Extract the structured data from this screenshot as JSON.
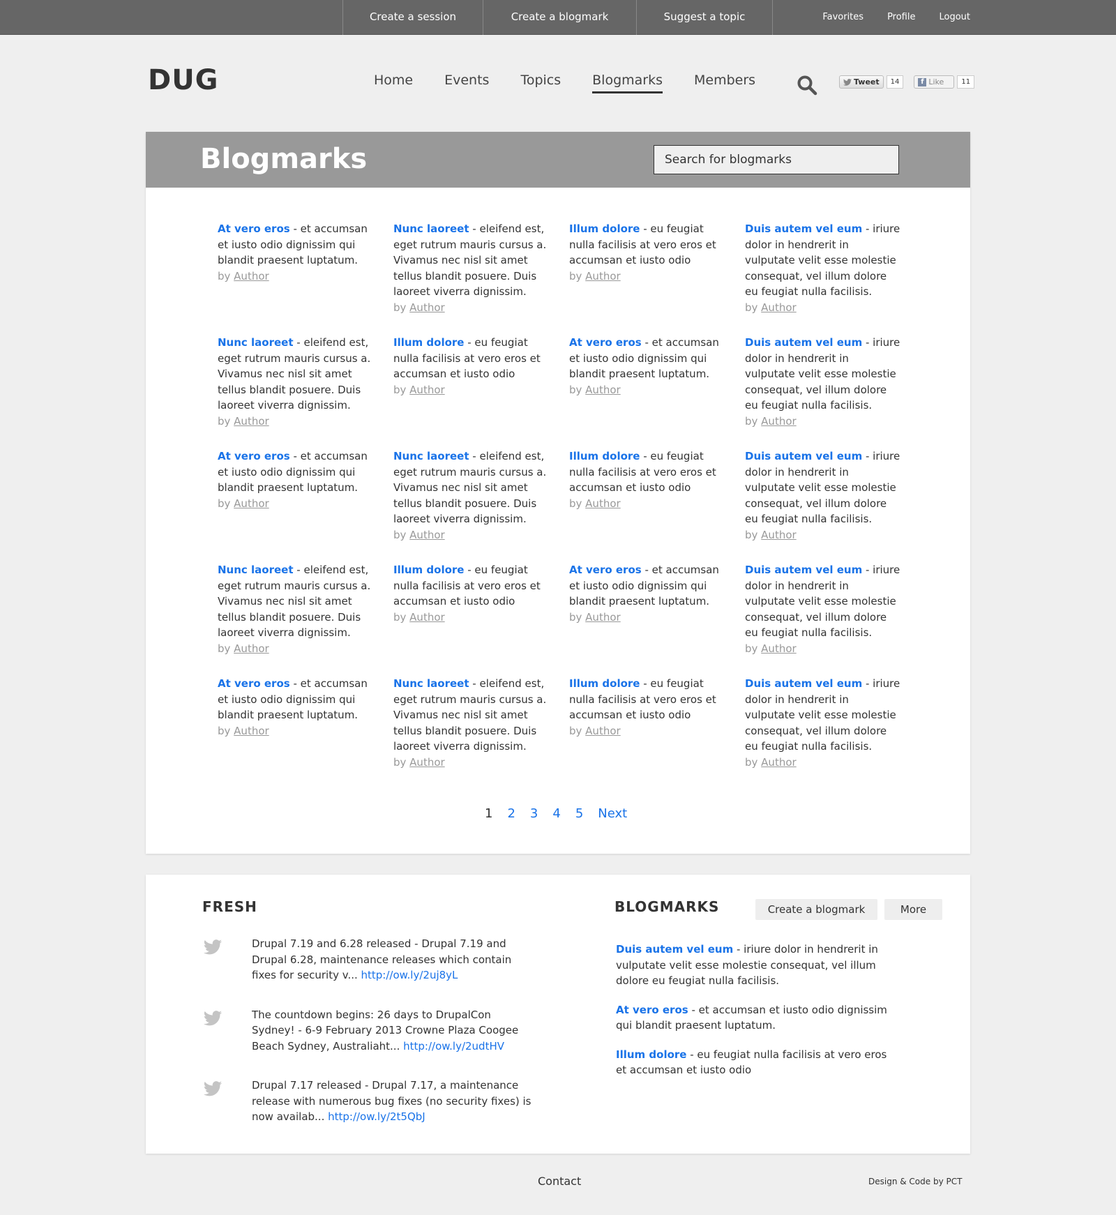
{
  "topbar": {
    "actions": [
      "Create a session",
      "Create a blogmark",
      "Suggest a topic"
    ],
    "user": [
      "Favorites",
      "Profile",
      "Logout"
    ]
  },
  "header": {
    "logo": "DUG",
    "nav": [
      "Home",
      "Events",
      "Topics",
      "Blogmarks",
      "Members"
    ],
    "active_nav": "Blogmarks",
    "tweet_label": "Tweet",
    "tweet_count": "14",
    "like_label": "Like",
    "like_count": "11"
  },
  "main": {
    "title": "Blogmarks",
    "search_placeholder": "Search for blogmarks",
    "rows": [
      [
        {
          "title": "At vero eros",
          "body": " - et accumsan et iusto odio dignissim qui blandit praesent luptatum.",
          "by": "by ",
          "author": "Author"
        },
        {
          "title": "Nunc laoreet",
          "body": " - eleifend est, eget rutrum mauris cursus a. Vivamus nec nisl sit amet tellus blandit posuere. Duis laoreet viverra dignissim.",
          "by": "by ",
          "author": "Author"
        },
        {
          "title": "Illum dolore",
          "body": " - eu feugiat nulla facilisis at vero eros et accumsan et iusto odio",
          "by": "by ",
          "author": "Author"
        },
        {
          "title": "Duis autem vel eum",
          "body": " - iriure dolor in hendrerit in vulputate velit esse molestie consequat, vel illum dolore eu feugiat nulla facilisis.",
          "by": "by ",
          "author": "Author"
        }
      ],
      [
        {
          "title": "Nunc laoreet",
          "body": " - eleifend est, eget rutrum mauris cursus a. Vivamus nec nisl sit amet tellus blandit posuere. Duis laoreet viverra dignissim.",
          "by": "by ",
          "author": "Author"
        },
        {
          "title": "Illum dolore",
          "body": " - eu feugiat nulla facilisis at vero eros et accumsan et iusto odio",
          "by": "by ",
          "author": "Author"
        },
        {
          "title": "At vero eros",
          "body": " - et accumsan et iusto odio dignissim qui blandit praesent luptatum.",
          "by": "by ",
          "author": "Author"
        },
        {
          "title": "Duis autem vel eum",
          "body": " - iriure dolor in hendrerit in vulputate velit esse molestie consequat, vel illum dolore eu feugiat nulla facilisis.",
          "by": "by ",
          "author": "Author"
        }
      ],
      [
        {
          "title": "At vero eros",
          "body": " - et accumsan et iusto odio dignissim qui blandit praesent luptatum.",
          "by": "by ",
          "author": "Author"
        },
        {
          "title": "Nunc laoreet",
          "body": " - eleifend est, eget rutrum mauris cursus a. Vivamus nec nisl sit amet tellus blandit posuere. Duis laoreet viverra dignissim.",
          "by": "by ",
          "author": "Author"
        },
        {
          "title": "Illum dolore",
          "body": " - eu feugiat nulla facilisis at vero eros et accumsan et iusto odio",
          "by": "by ",
          "author": "Author"
        },
        {
          "title": "Duis autem vel eum",
          "body": " - iriure dolor in hendrerit in vulputate velit esse molestie consequat, vel illum dolore eu feugiat nulla facilisis.",
          "by": "by ",
          "author": "Author"
        }
      ],
      [
        {
          "title": "Nunc laoreet",
          "body": " - eleifend est, eget rutrum mauris cursus a. Vivamus nec nisl sit amet tellus blandit posuere. Duis laoreet viverra dignissim.",
          "by": "by ",
          "author": "Author"
        },
        {
          "title": "Illum dolore",
          "body": " - eu feugiat nulla facilisis at vero eros et accumsan et iusto odio",
          "by": "by ",
          "author": "Author"
        },
        {
          "title": "At vero eros",
          "body": " - et accumsan et iusto odio dignissim qui blandit praesent luptatum.",
          "by": "by ",
          "author": "Author"
        },
        {
          "title": "Duis autem vel eum",
          "body": " - iriure dolor in hendrerit in vulputate velit esse molestie consequat, vel illum dolore eu feugiat nulla facilisis.",
          "by": "by ",
          "author": "Author"
        }
      ],
      [
        {
          "title": "At vero eros",
          "body": " - et accumsan et iusto odio dignissim qui blandit praesent luptatum.",
          "by": "by ",
          "author": "Author"
        },
        {
          "title": "Nunc laoreet",
          "body": " - eleifend est, eget rutrum mauris cursus a. Vivamus nec nisl sit amet tellus blandit posuere. Duis laoreet viverra dignissim.",
          "by": "by ",
          "author": "Author"
        },
        {
          "title": "Illum dolore",
          "body": " - eu feugiat nulla facilisis at vero eros et accumsan et iusto odio",
          "by": "by ",
          "author": "Author"
        },
        {
          "title": "Duis autem vel eum",
          "body": " - iriure dolor in hendrerit in vulputate velit esse molestie consequat, vel illum dolore eu feugiat nulla facilisis.",
          "by": "by ",
          "author": "Author"
        }
      ]
    ],
    "pager": {
      "current": "1",
      "pages": [
        "2",
        "3",
        "4",
        "5"
      ],
      "next": "Next"
    }
  },
  "fresh": {
    "title": "FRESH",
    "tweets": [
      {
        "text": "Drupal 7.19 and 6.28 released - Drupal 7.19 and Drupal 6.28, maintenance releases which contain fixes for security v... ",
        "link": "http://ow.ly/2uj8yL"
      },
      {
        "text": "The countdown begins: 26 days to DrupalCon Sydney! - 6-9 February 2013 Crowne Plaza Coogee Beach Sydney, Australiaht... ",
        "link": "http://ow.ly/2udtHV"
      },
      {
        "text": "Drupal 7.17 released - Drupal 7.17, a maintenance release with numerous bug fixes (no security fixes) is now availab... ",
        "link": "http://ow.ly/2t5QbJ"
      }
    ]
  },
  "bm_widget": {
    "title": "BLOGMARKS",
    "create_label": "Create a blogmark",
    "more_label": "More",
    "items": [
      {
        "title": "Duis autem vel eum",
        "body": " - iriure dolor in hendrerit in vulputate velit esse molestie consequat, vel illum dolore eu feugiat nulla facilisis."
      },
      {
        "title": "At vero eros",
        "body": " - et accumsan et iusto odio dignissim qui blandit praesent luptatum."
      },
      {
        "title": "Illum dolore",
        "body": " - eu feugiat nulla facilisis at vero eros et accumsan et iusto odio"
      }
    ]
  },
  "footer": {
    "contact": "Contact",
    "credit": "Design & Code by PCT"
  }
}
